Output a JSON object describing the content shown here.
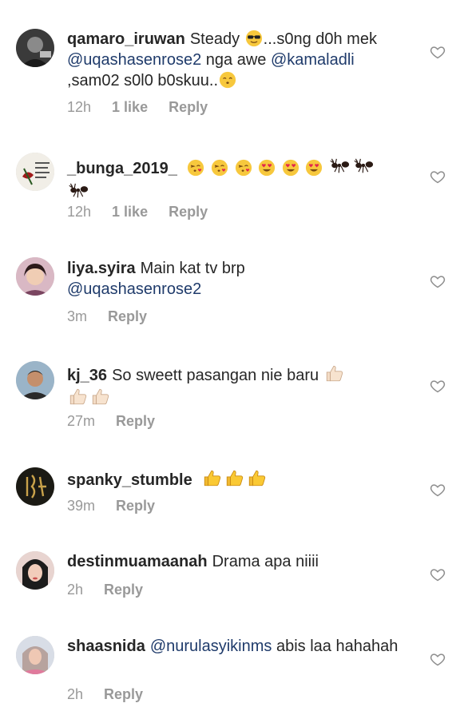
{
  "comments": [
    {
      "username": "qamaro_iruwan",
      "text_a": "Steady",
      "text_b": "...s0ng d0h mek",
      "mention_1": "@uqashasenrose2",
      "text_c": "nga awe",
      "mention_2": "@kamaladli",
      "text_d": ",sam02 s0l0 b0skuu..",
      "time": "12h",
      "likes": "1 like",
      "reply": "Reply"
    },
    {
      "username": "_bunga_2019_",
      "time": "12h",
      "likes": "1 like",
      "reply": "Reply"
    },
    {
      "username": "liya.syira",
      "text_a": "Main kat tv brp",
      "mention_1": "@uqashasenrose2",
      "time": "3m",
      "reply": "Reply"
    },
    {
      "username": "kj_36",
      "text_a": "So sweett pasangan nie baru",
      "time": "27m",
      "reply": "Reply"
    },
    {
      "username": "spanky_stumble",
      "time": "39m",
      "reply": "Reply"
    },
    {
      "username": "destinmuamaanah",
      "text_a": "Drama apa niiii",
      "time": "2h",
      "reply": "Reply"
    },
    {
      "username": "shaasnida",
      "mention_1": "@nurulasyikinms",
      "text_a": "abis laa hahahah",
      "time": "2h",
      "reply": "Reply"
    }
  ],
  "icons": {
    "like": "heart-outline-icon",
    "emoji_sunglasses": "sunglasses-face-emoji",
    "emoji_kiss": "kissing-face-emoji",
    "emoji_blow_kiss": "face-blowing-kiss-emoji",
    "emoji_heart_eyes": "heart-eyes-emoji",
    "emoji_ant": "ant-emoji",
    "emoji_thumbs_up": "thumbs-up-emoji"
  },
  "colors": {
    "text": "#262626",
    "meta": "#999999",
    "mention": "#1f3b6b"
  }
}
